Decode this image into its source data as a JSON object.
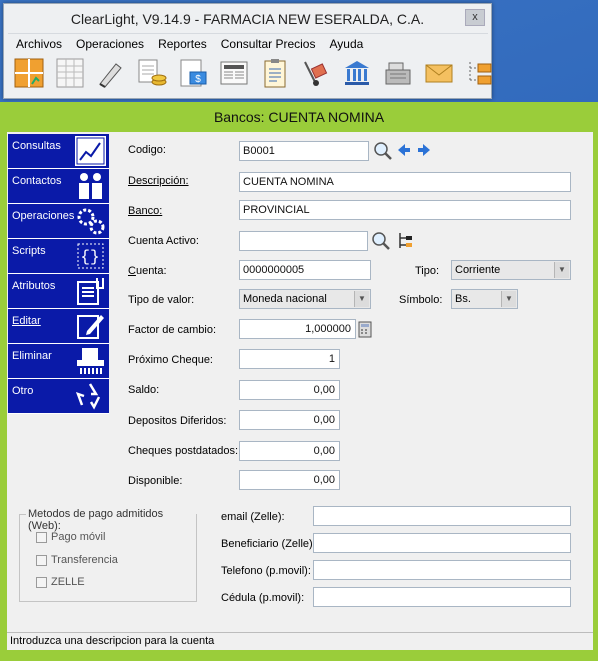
{
  "main_window": {
    "title": "ClearLight, V9.14.9 - FARMACIA NEW ESERALDA, C.A.",
    "close": "x",
    "menu": [
      "Archivos",
      "Operaciones",
      "Reportes",
      "Consultar Precios",
      "Ayuda"
    ],
    "toolbar_icons": [
      "grid-chart-icon",
      "spreadsheet-icon",
      "pen-icon",
      "documents-coins-icon",
      "invoice-icon",
      "newspaper-icon",
      "clipboard-icon",
      "hand-truck-icon",
      "bank-icon",
      "cash-register-icon",
      "envelope-icon",
      "folder-tree-icon"
    ]
  },
  "dialog": {
    "title": "Bancos: CUENTA NOMINA",
    "nav": [
      {
        "label": "Consultas",
        "icon": "chart-icon",
        "active": true
      },
      {
        "label": "Contactos",
        "icon": "people-icon",
        "active": false
      },
      {
        "label": "Operaciones",
        "icon": "gears-icon",
        "active": false
      },
      {
        "label": "Scripts",
        "icon": "script-icon",
        "active": false
      },
      {
        "label": "Atributos",
        "icon": "list-attributes-icon",
        "active": false
      },
      {
        "label": "Editar",
        "icon": "edit-pencil-icon",
        "active": false
      },
      {
        "label": "Eliminar",
        "icon": "shredder-icon",
        "active": false
      },
      {
        "label": "Otro",
        "icon": "recycle-icon",
        "active": false
      }
    ],
    "form": {
      "codigo_label": "Codigo:",
      "codigo": "B0001",
      "descripcion_label": "Descripción:",
      "descripcion": "CUENTA NOMINA",
      "banco_label": "Banco:",
      "banco": "PROVINCIAL",
      "cuenta_activo_label": "Cuenta Activo:",
      "cuenta_activo": "",
      "cuenta_label": "Cuenta:",
      "cuenta": "0000000005",
      "tipo_label": "Tipo:",
      "tipo": "Corriente",
      "tipo_valor_label": "Tipo de valor:",
      "tipo_valor": "Moneda nacional",
      "simbolo_label": "Símbolo:",
      "simbolo": "Bs.",
      "factor_label": "Factor de cambio:",
      "factor": "1,000000",
      "proximo_label": "Próximo Cheque:",
      "proximo": "1",
      "saldo_label": "Saldo:",
      "saldo": "0,00",
      "depositos_label": "Depositos Diferidos:",
      "depositos": "0,00",
      "cheques_label": "Cheques postdatados:",
      "cheques": "0,00",
      "disponible_label": "Disponible:",
      "disponible": "0,00"
    },
    "metodos": {
      "title": "Metodos de pago admitidos (Web):",
      "options": [
        "Pago móvil",
        "Transferencia",
        "ZELLE"
      ]
    },
    "web_fields": {
      "email_label": "email (Zelle):",
      "beneficiario_label": "Beneficiario (Zelle):",
      "telefono_label": "Telefono (p.movil):",
      "cedula_label": "Cédula (p.movil):"
    },
    "status": "Introduzca una descripcion para la cuenta"
  }
}
